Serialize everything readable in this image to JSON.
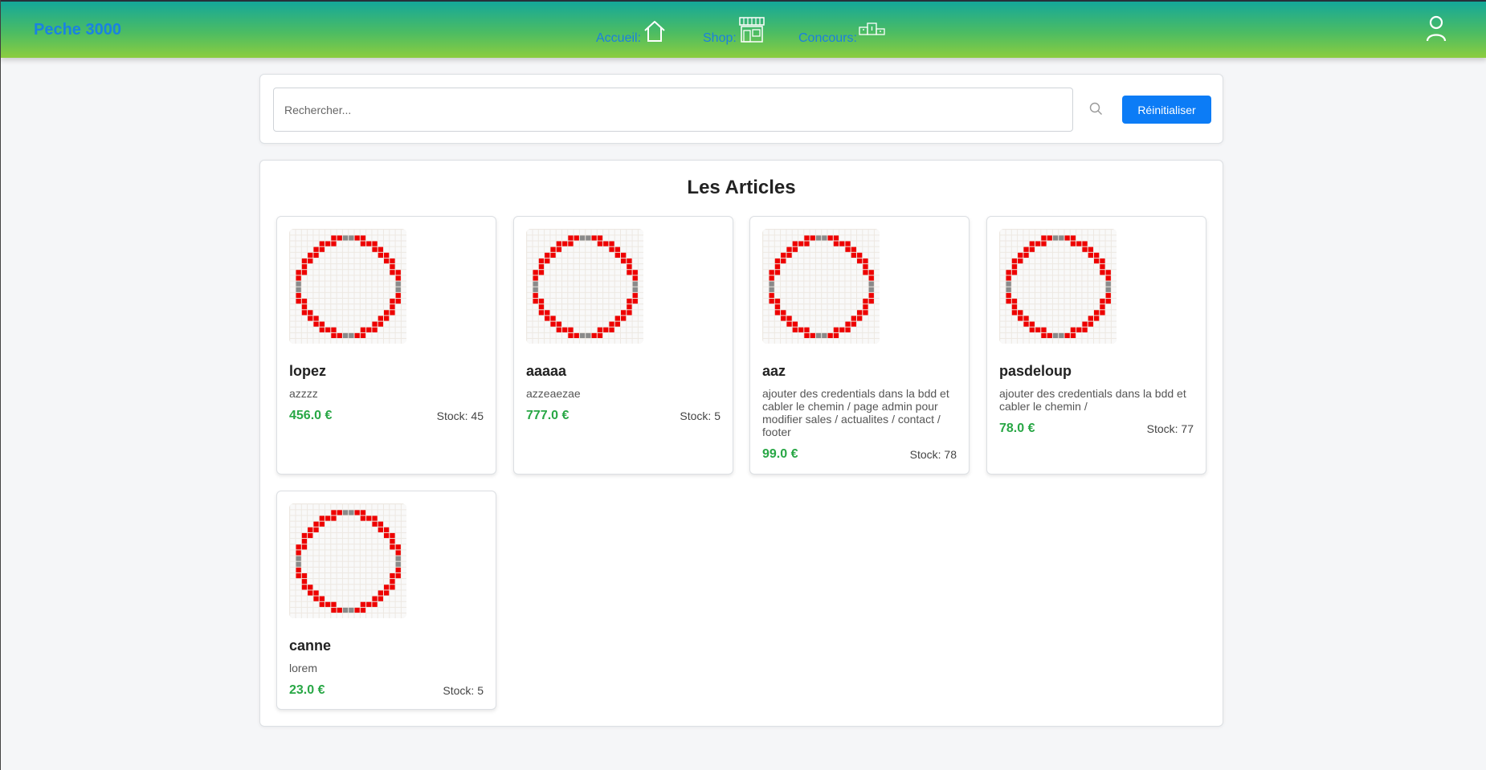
{
  "navbar": {
    "brand": "Peche 3000",
    "links": [
      {
        "label": "Accueil:",
        "icon": "home-icon"
      },
      {
        "label": "Shop:",
        "icon": "shop-icon"
      },
      {
        "label": "Concours:",
        "icon": "podium-icon"
      }
    ],
    "user_icon": "user-icon"
  },
  "search": {
    "placeholder": "Rechercher...",
    "icon": "search-icon",
    "reset_label": "Réinitialiser"
  },
  "articles": {
    "title": "Les Articles",
    "items": [
      {
        "name": "lopez",
        "description": "azzzz",
        "price": "456.0 €",
        "stock": "Stock: 45"
      },
      {
        "name": "aaaaa",
        "description": "azzeaezae",
        "price": "777.0 €",
        "stock": "Stock: 5"
      },
      {
        "name": "aaz",
        "description": "ajouter des credentials dans la bdd et cabler le chemin / page admin pour modifier sales / actualites / contact / footer",
        "price": "99.0 €",
        "stock": "Stock: 78"
      },
      {
        "name": "pasdeloup",
        "description": "ajouter des credentials dans la bdd et cabler le chemin /",
        "price": "78.0 €",
        "stock": "Stock: 77"
      },
      {
        "name": "canne",
        "description": "lorem",
        "price": "23.0 €",
        "stock": "Stock: 5"
      }
    ]
  },
  "colors": {
    "brand": "#1a82e2",
    "price": "#28a745",
    "button": "#0c7cf6",
    "navbar_top": "#14a89a",
    "navbar_bottom": "#8ccd3f"
  }
}
